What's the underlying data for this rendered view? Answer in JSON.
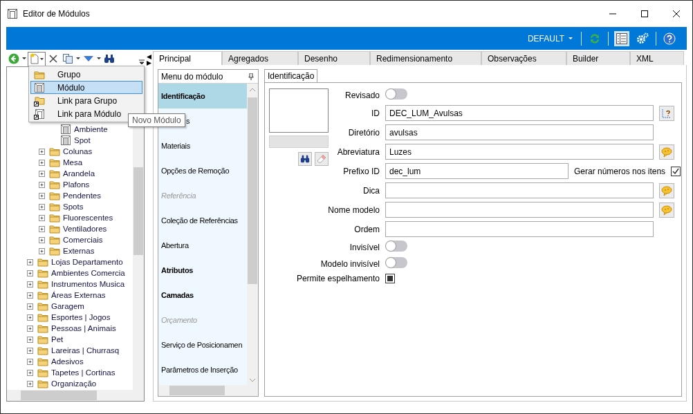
{
  "window": {
    "title": "Editor de Módulos"
  },
  "header_bar": {
    "profile": "DEFAULT"
  },
  "new_menu": {
    "items": [
      {
        "label": "Grupo",
        "kind": "folder",
        "selected": false
      },
      {
        "label": "Módulo",
        "kind": "module",
        "selected": true
      },
      {
        "label": "Link para Grupo",
        "kind": "folder_link",
        "selected": false
      },
      {
        "label": "Link para Módulo",
        "kind": "module_link",
        "selected": false
      }
    ],
    "tooltip": "Novo Módulo"
  },
  "tree": {
    "items": [
      {
        "children": [
          {
            "children": [
              {
                "children": [
                  {
                    "label": "Ambiente",
                    "kind": "module"
                  },
                  {
                    "label": "Spot",
                    "kind": "module"
                  }
                ]
              },
              {
                "label": "Colunas",
                "kind": "folder",
                "expanded": false
              },
              {
                "label": "Mesa",
                "kind": "folder",
                "expanded": false
              },
              {
                "label": "Arandela",
                "kind": "folder",
                "expanded": false
              },
              {
                "label": "Plafons",
                "kind": "folder",
                "expanded": false
              },
              {
                "label": "Pendentes",
                "kind": "folder",
                "expanded": false
              },
              {
                "label": "Spots",
                "kind": "folder",
                "expanded": false
              },
              {
                "label": "Fluorescentes",
                "kind": "folder",
                "expanded": false
              },
              {
                "label": "Ventiladores",
                "kind": "folder",
                "expanded": false
              },
              {
                "label": "Comerciais",
                "kind": "folder",
                "expanded": false
              },
              {
                "label": "Externas",
                "kind": "folder",
                "expanded": false
              }
            ]
          },
          {
            "label": "Lojas Departamento",
            "kind": "folder",
            "expanded": false
          },
          {
            "label": "Ambientes Comercia",
            "kind": "folder",
            "expanded": false
          },
          {
            "label": "Instrumentos Musica",
            "kind": "folder",
            "expanded": false
          },
          {
            "label": "Áreas Externas",
            "kind": "folder",
            "expanded": false
          },
          {
            "label": "Garagem",
            "kind": "folder",
            "expanded": false
          },
          {
            "label": "Esportes | Jogos",
            "kind": "folder",
            "expanded": false
          },
          {
            "label": "Pessoas | Animais",
            "kind": "folder",
            "expanded": false
          },
          {
            "label": "Pet",
            "kind": "folder",
            "expanded": false
          },
          {
            "label": "Lareiras | Churrasq",
            "kind": "folder",
            "expanded": false
          },
          {
            "label": "Adesivos",
            "kind": "folder",
            "expanded": false
          },
          {
            "label": "Tapetes | Cortinas",
            "kind": "folder",
            "expanded": false
          },
          {
            "label": "Organização",
            "kind": "folder",
            "expanded": false
          }
        ]
      }
    ]
  },
  "tabs": [
    {
      "label": "Principal",
      "selected": true
    },
    {
      "label": "Agregados",
      "selected": false
    },
    {
      "label": "Desenho",
      "selected": false
    },
    {
      "label": "Redimensionamento",
      "selected": false
    },
    {
      "label": "Observações",
      "selected": false
    },
    {
      "label": "Builder",
      "selected": false
    },
    {
      "label": "XML",
      "selected": false
    }
  ],
  "module_menu": {
    "title": "Menu do módulo",
    "items": [
      {
        "label": "Identificação",
        "kind": "bold",
        "selected": true
      },
      {
        "label": "s",
        "kind": "covered",
        "selected": false
      },
      {
        "label": "Materiais",
        "kind": "item",
        "selected": false
      },
      {
        "label": "Opções de Remoção",
        "kind": "item",
        "selected": false
      },
      {
        "label": "Referência",
        "kind": "section",
        "selected": false
      },
      {
        "label": "Coleção de Referências",
        "kind": "item",
        "selected": false
      },
      {
        "label": "Abertura",
        "kind": "item",
        "selected": false
      },
      {
        "label": "Atributos",
        "kind": "bold",
        "selected": false
      },
      {
        "label": "Camadas",
        "kind": "bold",
        "selected": false
      },
      {
        "label": "Orçamento",
        "kind": "section",
        "selected": false
      },
      {
        "label": "Serviço de Posicionamen",
        "kind": "item",
        "selected": false
      },
      {
        "label": "Parâmetros de Inserção",
        "kind": "item",
        "selected": false
      }
    ]
  },
  "sub_tabs": [
    {
      "label": "Identificação",
      "selected": true
    }
  ],
  "form": {
    "rows": [
      {
        "label": "Revisado",
        "kind": "toggle",
        "on": false
      },
      {
        "label": "ID",
        "kind": "text",
        "value": "DEC_LUM_Avulsas",
        "id_button": true
      },
      {
        "label": "Diretório",
        "kind": "text",
        "value": "avulsas"
      },
      {
        "label": "Abreviatura",
        "kind": "text",
        "value": "Luzes",
        "translate_button": true
      },
      {
        "label": "Prefixo ID",
        "kind": "text_check",
        "value": "dec_lum",
        "check_label": "Gerar números nos itens",
        "checked": true
      },
      {
        "label": "Dica",
        "kind": "text",
        "translate_button": true
      },
      {
        "label": "Nome modelo",
        "kind": "text",
        "translate_button": true
      },
      {
        "label": "Ordem",
        "kind": "text"
      },
      {
        "label": "Invisível",
        "kind": "toggle",
        "on": false
      },
      {
        "label": "Modelo invisível",
        "kind": "toggle",
        "on": false
      },
      {
        "label": "Permite espelhamento",
        "kind": "checkbox",
        "indeterminate": true
      }
    ]
  }
}
